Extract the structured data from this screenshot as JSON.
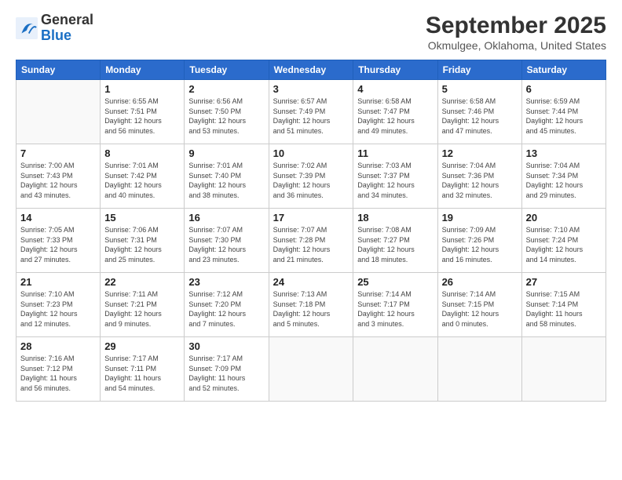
{
  "header": {
    "logo_line1": "General",
    "logo_line2": "Blue",
    "title": "September 2025",
    "subtitle": "Okmulgee, Oklahoma, United States"
  },
  "weekdays": [
    "Sunday",
    "Monday",
    "Tuesday",
    "Wednesday",
    "Thursday",
    "Friday",
    "Saturday"
  ],
  "weeks": [
    [
      {
        "day": "",
        "info": ""
      },
      {
        "day": "1",
        "info": "Sunrise: 6:55 AM\nSunset: 7:51 PM\nDaylight: 12 hours\nand 56 minutes."
      },
      {
        "day": "2",
        "info": "Sunrise: 6:56 AM\nSunset: 7:50 PM\nDaylight: 12 hours\nand 53 minutes."
      },
      {
        "day": "3",
        "info": "Sunrise: 6:57 AM\nSunset: 7:49 PM\nDaylight: 12 hours\nand 51 minutes."
      },
      {
        "day": "4",
        "info": "Sunrise: 6:58 AM\nSunset: 7:47 PM\nDaylight: 12 hours\nand 49 minutes."
      },
      {
        "day": "5",
        "info": "Sunrise: 6:58 AM\nSunset: 7:46 PM\nDaylight: 12 hours\nand 47 minutes."
      },
      {
        "day": "6",
        "info": "Sunrise: 6:59 AM\nSunset: 7:44 PM\nDaylight: 12 hours\nand 45 minutes."
      }
    ],
    [
      {
        "day": "7",
        "info": "Sunrise: 7:00 AM\nSunset: 7:43 PM\nDaylight: 12 hours\nand 43 minutes."
      },
      {
        "day": "8",
        "info": "Sunrise: 7:01 AM\nSunset: 7:42 PM\nDaylight: 12 hours\nand 40 minutes."
      },
      {
        "day": "9",
        "info": "Sunrise: 7:01 AM\nSunset: 7:40 PM\nDaylight: 12 hours\nand 38 minutes."
      },
      {
        "day": "10",
        "info": "Sunrise: 7:02 AM\nSunset: 7:39 PM\nDaylight: 12 hours\nand 36 minutes."
      },
      {
        "day": "11",
        "info": "Sunrise: 7:03 AM\nSunset: 7:37 PM\nDaylight: 12 hours\nand 34 minutes."
      },
      {
        "day": "12",
        "info": "Sunrise: 7:04 AM\nSunset: 7:36 PM\nDaylight: 12 hours\nand 32 minutes."
      },
      {
        "day": "13",
        "info": "Sunrise: 7:04 AM\nSunset: 7:34 PM\nDaylight: 12 hours\nand 29 minutes."
      }
    ],
    [
      {
        "day": "14",
        "info": "Sunrise: 7:05 AM\nSunset: 7:33 PM\nDaylight: 12 hours\nand 27 minutes."
      },
      {
        "day": "15",
        "info": "Sunrise: 7:06 AM\nSunset: 7:31 PM\nDaylight: 12 hours\nand 25 minutes."
      },
      {
        "day": "16",
        "info": "Sunrise: 7:07 AM\nSunset: 7:30 PM\nDaylight: 12 hours\nand 23 minutes."
      },
      {
        "day": "17",
        "info": "Sunrise: 7:07 AM\nSunset: 7:28 PM\nDaylight: 12 hours\nand 21 minutes."
      },
      {
        "day": "18",
        "info": "Sunrise: 7:08 AM\nSunset: 7:27 PM\nDaylight: 12 hours\nand 18 minutes."
      },
      {
        "day": "19",
        "info": "Sunrise: 7:09 AM\nSunset: 7:26 PM\nDaylight: 12 hours\nand 16 minutes."
      },
      {
        "day": "20",
        "info": "Sunrise: 7:10 AM\nSunset: 7:24 PM\nDaylight: 12 hours\nand 14 minutes."
      }
    ],
    [
      {
        "day": "21",
        "info": "Sunrise: 7:10 AM\nSunset: 7:23 PM\nDaylight: 12 hours\nand 12 minutes."
      },
      {
        "day": "22",
        "info": "Sunrise: 7:11 AM\nSunset: 7:21 PM\nDaylight: 12 hours\nand 9 minutes."
      },
      {
        "day": "23",
        "info": "Sunrise: 7:12 AM\nSunset: 7:20 PM\nDaylight: 12 hours\nand 7 minutes."
      },
      {
        "day": "24",
        "info": "Sunrise: 7:13 AM\nSunset: 7:18 PM\nDaylight: 12 hours\nand 5 minutes."
      },
      {
        "day": "25",
        "info": "Sunrise: 7:14 AM\nSunset: 7:17 PM\nDaylight: 12 hours\nand 3 minutes."
      },
      {
        "day": "26",
        "info": "Sunrise: 7:14 AM\nSunset: 7:15 PM\nDaylight: 12 hours\nand 0 minutes."
      },
      {
        "day": "27",
        "info": "Sunrise: 7:15 AM\nSunset: 7:14 PM\nDaylight: 11 hours\nand 58 minutes."
      }
    ],
    [
      {
        "day": "28",
        "info": "Sunrise: 7:16 AM\nSunset: 7:12 PM\nDaylight: 11 hours\nand 56 minutes."
      },
      {
        "day": "29",
        "info": "Sunrise: 7:17 AM\nSunset: 7:11 PM\nDaylight: 11 hours\nand 54 minutes."
      },
      {
        "day": "30",
        "info": "Sunrise: 7:17 AM\nSunset: 7:09 PM\nDaylight: 11 hours\nand 52 minutes."
      },
      {
        "day": "",
        "info": ""
      },
      {
        "day": "",
        "info": ""
      },
      {
        "day": "",
        "info": ""
      },
      {
        "day": "",
        "info": ""
      }
    ]
  ]
}
